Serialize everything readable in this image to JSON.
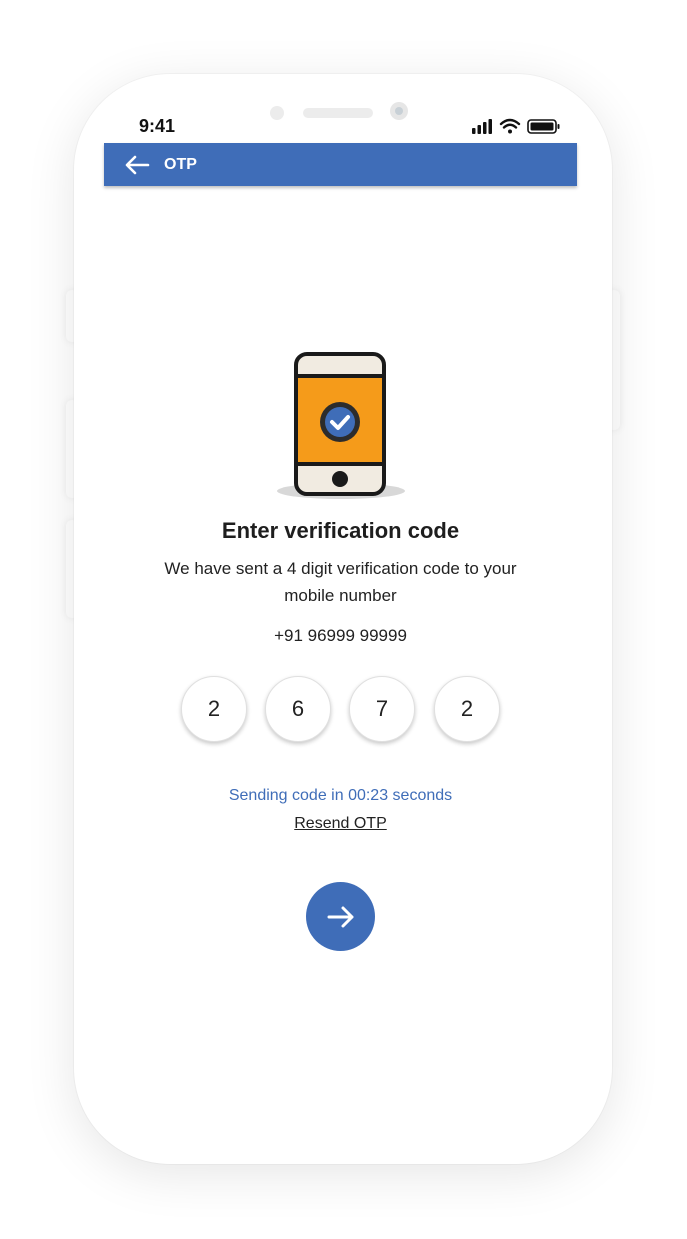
{
  "status_bar": {
    "time": "9:41"
  },
  "app_bar": {
    "title": "OTP",
    "back_icon": "arrow-left-icon"
  },
  "illustration": {
    "icon": "phone-verified-icon"
  },
  "content": {
    "heading": "Enter verification code",
    "description": "We have sent a 4 digit verification code to your mobile number",
    "phone_number": "+91 96999 99999"
  },
  "otp": {
    "digits": [
      "2",
      "6",
      "7",
      "2"
    ]
  },
  "timer": {
    "text": "Sending code in 00:23 seconds"
  },
  "resend": {
    "label": "Resend OTP"
  },
  "next_button": {
    "icon": "arrow-right-icon"
  },
  "colors": {
    "primary": "#3f6db8",
    "illustration_screen": "#f59b1a"
  }
}
